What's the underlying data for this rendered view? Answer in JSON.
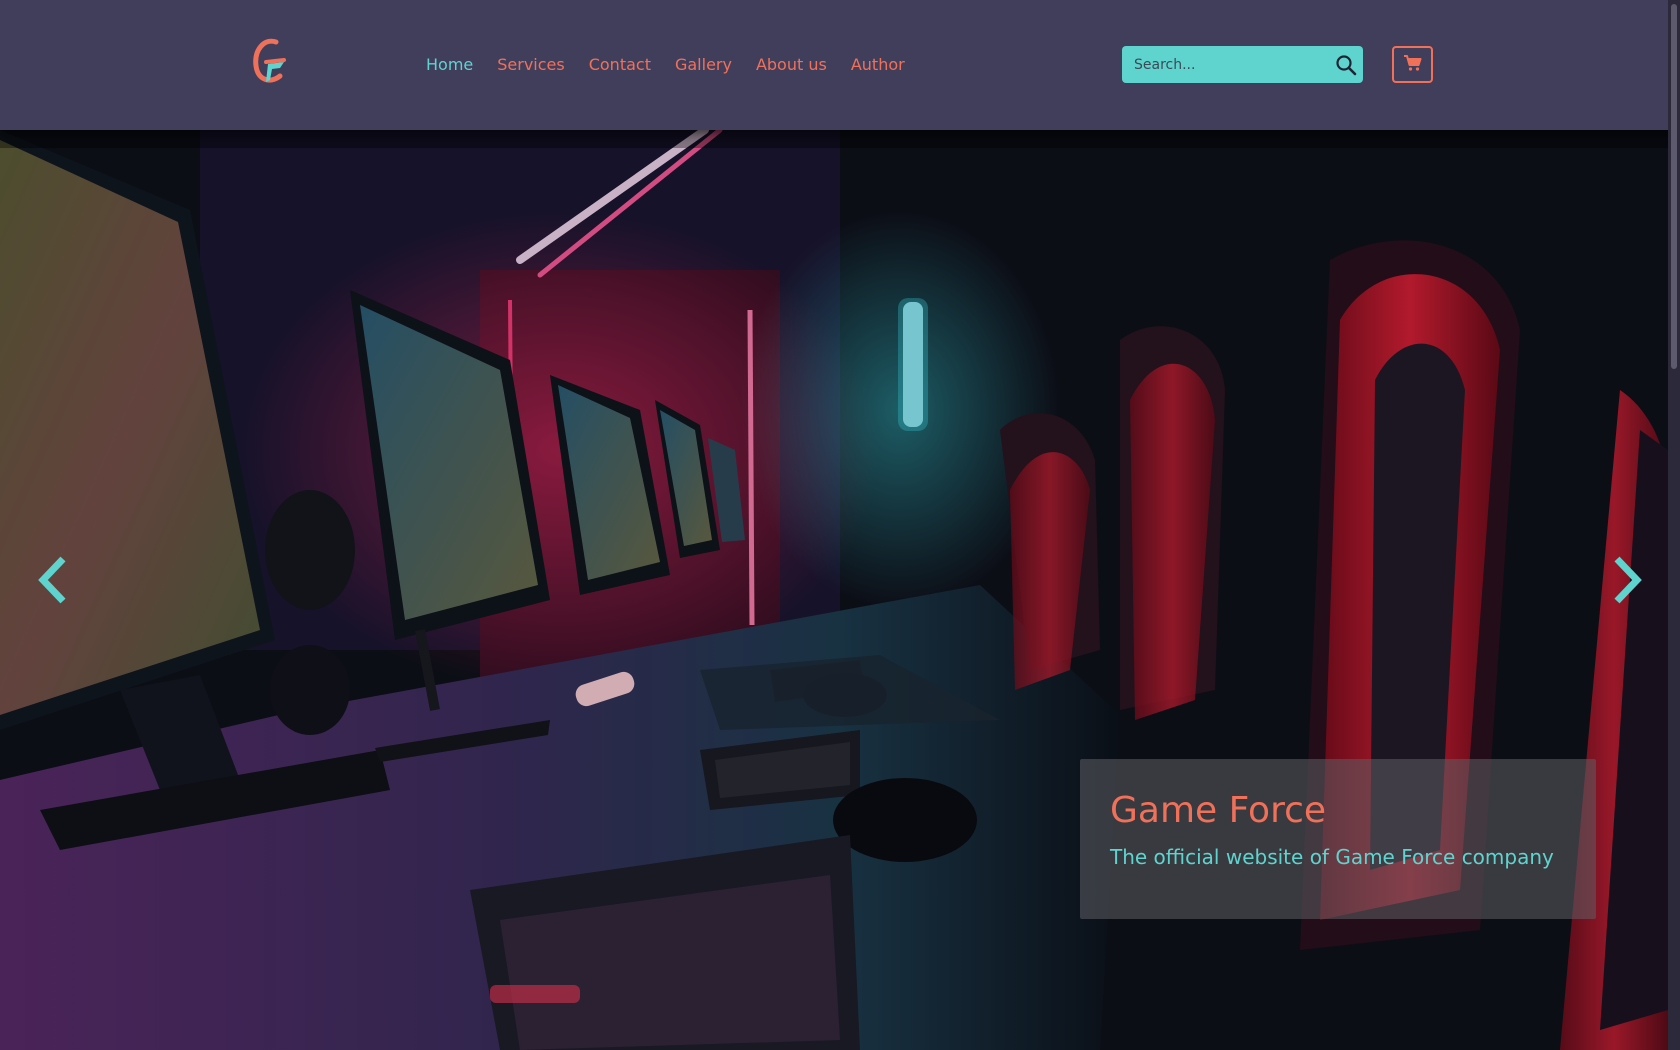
{
  "header": {
    "logo_icon": "game-force-logo",
    "nav": [
      {
        "label": "Home",
        "active": true
      },
      {
        "label": "Services",
        "active": false
      },
      {
        "label": "Contact",
        "active": false
      },
      {
        "label": "Gallery",
        "active": false
      },
      {
        "label": "About us",
        "active": false
      },
      {
        "label": "Author",
        "active": false
      }
    ],
    "search": {
      "placeholder": "Search...",
      "value": "",
      "icon": "search-icon"
    },
    "cart": {
      "icon": "shopping-cart-icon"
    }
  },
  "hero": {
    "image": "gaming-room-photo",
    "prev_icon": "chevron-left-icon",
    "next_icon": "chevron-right-icon",
    "caption": {
      "title": "Game Force",
      "subtitle": "The official website of Game Force company"
    }
  },
  "colors": {
    "header_bg": "#413e5c",
    "accent_coral": "#f0715a",
    "accent_teal": "#5fd4cf"
  }
}
